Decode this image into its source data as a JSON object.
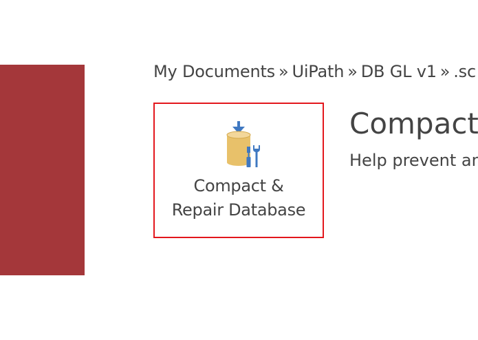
{
  "breadcrumb": {
    "items": [
      "My Documents",
      "UiPath",
      "DB GL v1",
      ".sc"
    ],
    "separator": "»"
  },
  "compact_repair": {
    "label_line1": "Compact &",
    "label_line2": "Repair Database",
    "icon": "compact-repair-database-icon"
  },
  "section": {
    "title": "Compact a",
    "description": "Help prevent an"
  },
  "colors": {
    "accent": "#a4373a",
    "highlight_border": "#e3161c",
    "icon_blue": "#3f78c1",
    "icon_tan": "#e8c16a"
  }
}
